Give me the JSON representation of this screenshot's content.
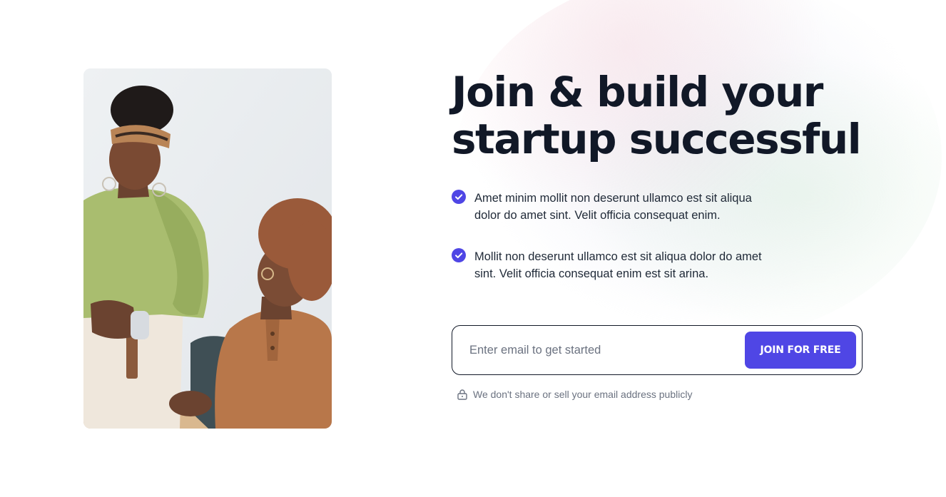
{
  "hero": {
    "headline_line1": "Join & build your",
    "headline_line2": "startup successful",
    "image_alt": "Two colleagues working together at a table"
  },
  "features": [
    {
      "line1": "Amet minim mollit non deserunt ullamco est sit aliqua",
      "line2": "dolor do amet sint. Velit officia consequat enim.",
      "icon": "check-circle-icon"
    },
    {
      "line1": "Mollit non deserunt ullamco est sit aliqua dolor do amet",
      "line2": "sint. Velit officia consequat enim est sit arina.",
      "icon": "check-circle-icon"
    }
  ],
  "signup": {
    "placeholder": "Enter email to get started",
    "value": "",
    "button_label": "JOIN FOR FREE",
    "privacy_note": "We don't share or sell your email address publicly",
    "privacy_icon": "lock-icon"
  },
  "colors": {
    "accent": "#4f46e5",
    "heading": "#111827",
    "body": "#1f2937",
    "muted": "#6b7280"
  }
}
